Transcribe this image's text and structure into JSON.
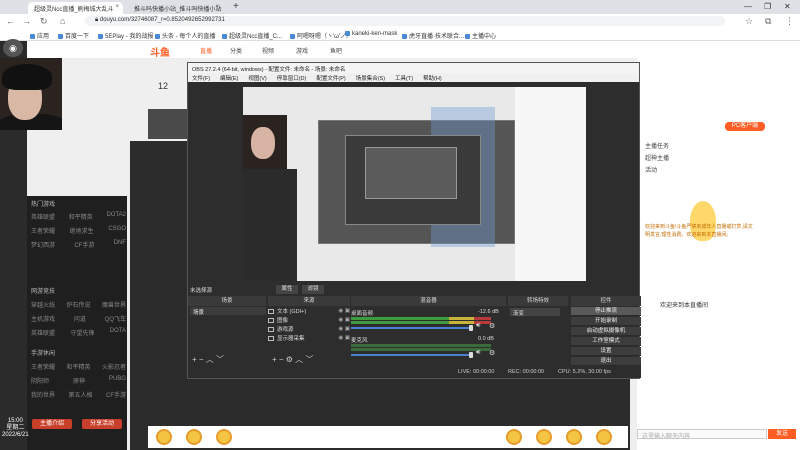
{
  "browser": {
    "tabs": [
      {
        "label": "超级灵Ncc直播_刷梅城大乱斗"
      },
      {
        "label": "推斗吗快播小站_推斗吗快播小站"
      }
    ],
    "url": "douyu.com/32746087_r=0.8520492652992731",
    "bookmarks": [
      "应用",
      "百度一下",
      "5EPlay - 我的战报",
      "头条 - 每个人的直播",
      "超级灵Ncc直播_C...",
      "阿嗯呀嗯（ヽ'ω'ノ）",
      "kaneki-ken-mask",
      "虎牙直播·技术联合...",
      "主播中心"
    ]
  },
  "douyu": {
    "logo": "斗鱼",
    "nav": [
      "首页",
      "直播",
      "分类",
      "视频",
      "游戏",
      "鱼吧"
    ],
    "follower_count": "12",
    "side_menu": {
      "groups": [
        {
          "title": "热门游戏",
          "rows": [
            [
              "英雄联盟",
              "和平精英",
              "DOTA2"
            ],
            [
              "王者荣耀",
              "绝地求生",
              "CSGO"
            ],
            [
              "梦幻西游",
              "CF手游",
              "DNF"
            ]
          ]
        },
        {
          "title": "网游竞技",
          "rows": [
            [
              "穿越火线",
              "炉石传说",
              "魔兽世界"
            ],
            [
              "主机游戏",
              "问道",
              "QQ飞车"
            ],
            [
              "英雄联盟",
              "守望先锋",
              "DOTA"
            ]
          ]
        },
        {
          "title": "手游休闲",
          "rows": [
            [
              "王者荣耀",
              "和平精英",
              "火影忍者"
            ],
            [
              "阴阳师",
              "原神",
              "PUBG"
            ],
            [
              "我的世界",
              "第五人格",
              "CF手游"
            ]
          ]
        }
      ],
      "btn_left": "主播介绍",
      "btn_right": "分享活动"
    },
    "chat": {
      "pc_button": "PC客户端",
      "lines": [
        "主播任务",
        "超神主播",
        "活动"
      ],
      "welcome": "欢迎来到斗鱼!斗鱼严禁未成年人直播或打赏,请文明发言,理性消费。欢迎来到本直播间。",
      "notice": "欢迎来到本直播间",
      "input_placeholder": "这里输入聊天内容",
      "send": "发送"
    }
  },
  "obs": {
    "title": "OBS 27.2.4 (64-bit, windows) - 配置文件: 未命名 - 场景: 未命名",
    "menu": [
      "文件(F)",
      "编辑(E)",
      "视图(V)",
      "停靠窗口(D)",
      "配置文件(P)",
      "场景集合(S)",
      "工具(T)",
      "帮助(H)"
    ],
    "no_source": "未选择源",
    "properties": "属性",
    "filters": "滤镜",
    "docks": {
      "scenes": "场景",
      "sources": "来源",
      "mixer": "混音器",
      "transitions": "转场特效",
      "controls": "控件"
    },
    "scene_items": [
      "场景"
    ],
    "sources": [
      {
        "name": "文本 (GDI+)",
        "icon": "text-icon"
      },
      {
        "name": "图像",
        "icon": "image-icon"
      },
      {
        "name": "游戏源",
        "icon": "game-icon"
      },
      {
        "name": "显示器采集",
        "icon": "monitor-icon"
      }
    ],
    "mixer": [
      {
        "name": "桌面音频",
        "db": "-12.6 dB"
      },
      {
        "name": "麦克风",
        "db": "0.0 dB"
      }
    ],
    "transition": "渐变",
    "controls": [
      "停止推流",
      "开始录制",
      "启动虚拟摄像机",
      "工作室模式",
      "设置",
      "退出"
    ],
    "status": {
      "live": "LIVE: 00:00:00",
      "rec": "REC: 00:00:00",
      "cpu": "CPU: 5.2%, 30.00 fps"
    }
  },
  "clock": {
    "time": "15:00",
    "day": "星期二",
    "date": "2022/6/21"
  }
}
